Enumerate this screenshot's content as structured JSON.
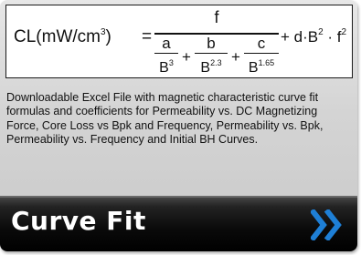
{
  "formula": {
    "lhs": "CL(mW/cm",
    "lhs_exp": "3",
    "lhs_close": ")",
    "equals": "=",
    "numerator": "f",
    "terms": [
      {
        "num": "a",
        "base": "B",
        "exp": "3"
      },
      {
        "num": "b",
        "base": "B",
        "exp": "2.3"
      },
      {
        "num": "c",
        "base": "B",
        "exp": "1.65"
      }
    ],
    "plus": "+",
    "tail_a": "+ d·B",
    "tail_a_exp": "2",
    "tail_b": " · f",
    "tail_b_exp": "2"
  },
  "description": "Downloadable Excel File with magnetic characteristic curve fit formulas and coefficients for Permeability vs. DC Magnetizing Force, Core Loss vs Bpk and Frequency, Permeability vs. Bpk, Permeability vs. Frequency and Initial BH Curves.",
  "cta": {
    "label": "Curve Fit",
    "icon": "double-chevron-right-icon"
  },
  "colors": {
    "accent": "#1e7fd6",
    "bar": "#000000",
    "panel": "#d4d4d4"
  }
}
